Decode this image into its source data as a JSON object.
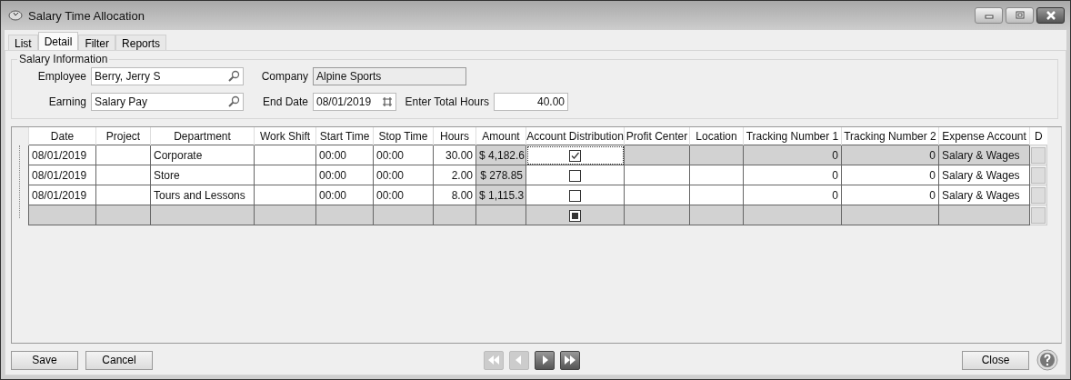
{
  "window": {
    "title": "Salary Time Allocation"
  },
  "tabs": [
    {
      "label": "List",
      "selected": false
    },
    {
      "label": "Detail",
      "selected": true
    },
    {
      "label": "Filter",
      "selected": false
    },
    {
      "label": "Reports",
      "selected": false
    }
  ],
  "salary_information": {
    "title": "Salary Information",
    "employee": {
      "label": "Employee",
      "value": "Berry, Jerry S"
    },
    "company": {
      "label": "Company",
      "value": "Alpine Sports"
    },
    "earning": {
      "label": "Earning",
      "value": "Salary Pay"
    },
    "end_date": {
      "label": "End Date",
      "value": "08/01/2019"
    },
    "total_hours": {
      "label": "Enter Total Hours",
      "value": "40.00"
    }
  },
  "table": {
    "columns": [
      "Date",
      "Project",
      "Department",
      "Work Shift",
      "Start Time",
      "Stop Time",
      "Hours",
      "Amount",
      "Account Distribution",
      "Profit Center",
      "Location",
      "Tracking Number 1",
      "Tracking Number 2",
      "Expense Account",
      "D"
    ],
    "rows": [
      {
        "kind": "data",
        "selected": true,
        "date": "08/01/2019",
        "department": "Corporate",
        "start_time": "00:00",
        "stop_time": "00:00",
        "hours": "30.00",
        "amount": "$ 4,182.6",
        "account_distribution": true,
        "tracking_number_1": "0",
        "tracking_number_2": "0",
        "expense_account": "Salary & Wages"
      },
      {
        "kind": "data",
        "selected": false,
        "date": "08/01/2019",
        "department": "Store",
        "start_time": "00:00",
        "stop_time": "00:00",
        "hours": "2.00",
        "amount": "$ 278.85",
        "account_distribution": false,
        "tracking_number_1": "0",
        "tracking_number_2": "0",
        "expense_account": "Salary & Wages"
      },
      {
        "kind": "data",
        "selected": false,
        "date": "08/01/2019",
        "department": "Tours and Lessons",
        "start_time": "00:00",
        "stop_time": "00:00",
        "hours": "8.00",
        "amount": "$ 1,115.3",
        "account_distribution": false,
        "tracking_number_1": "0",
        "tracking_number_2": "0",
        "expense_account": "Salary & Wages"
      },
      {
        "kind": "new",
        "selected": false
      }
    ]
  },
  "buttons": [
    {
      "label": "Save"
    },
    {
      "label": "Cancel"
    }
  ],
  "navigation": [
    {
      "kind": "first",
      "disabled": true
    },
    {
      "kind": "previous",
      "disabled": true
    },
    {
      "kind": "next",
      "disabled": false
    },
    {
      "kind": "last",
      "disabled": false
    }
  ],
  "close_button": {
    "label": "Close"
  }
}
